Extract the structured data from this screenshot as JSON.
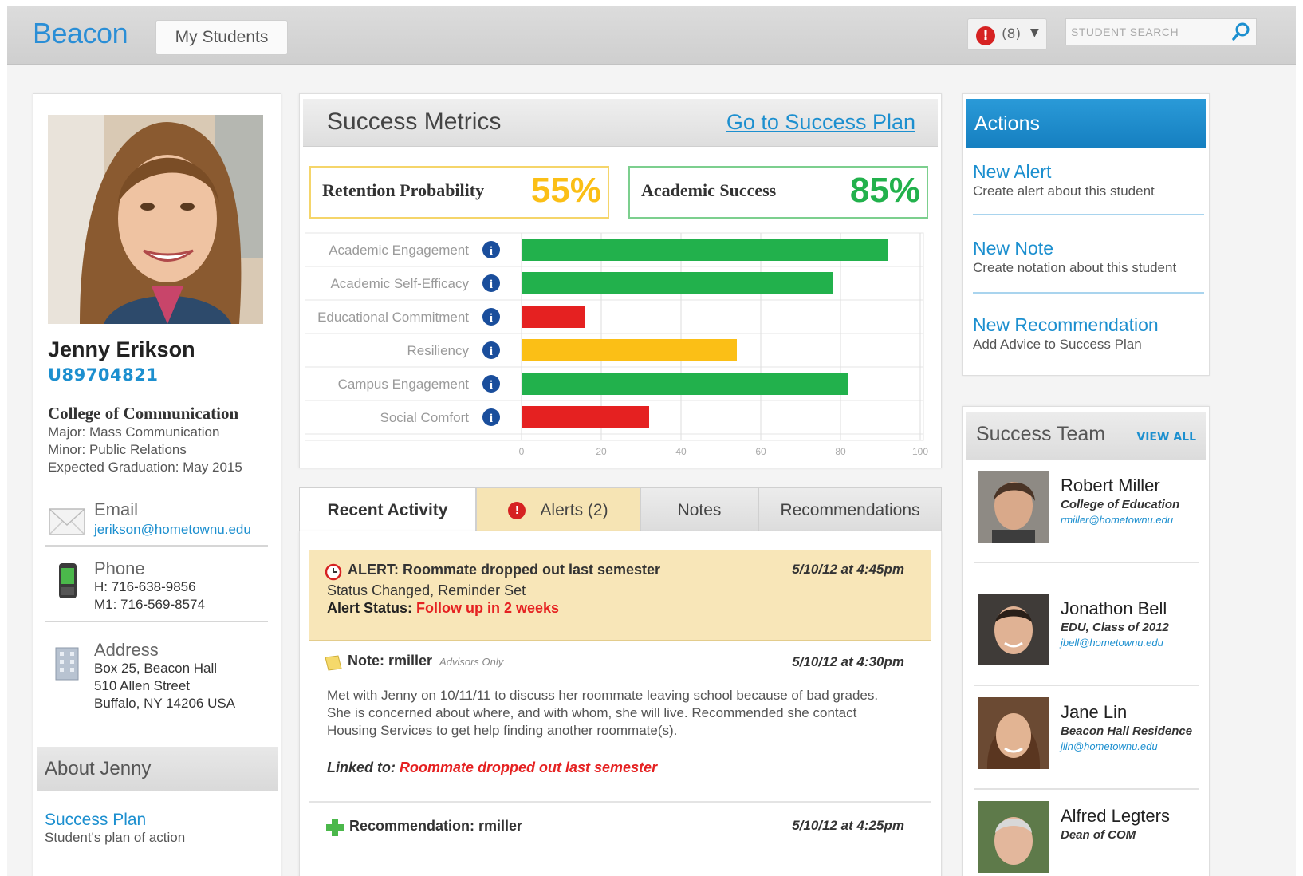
{
  "app": {
    "logo": "Beacon",
    "nav_button": "My Students",
    "alert_count": "(8)",
    "search_placeholder": "STUDENT SEARCH"
  },
  "student": {
    "name": "Jenny Erikson",
    "id": "U89704821",
    "college": "College of Communication",
    "major": "Major: Mass Communication",
    "minor": "Minor: Public Relations",
    "graduation": "Expected Graduation: May 2015",
    "email_label": "Email",
    "email": "jerikson@hometownu.edu",
    "phone_label": "Phone",
    "phone_h": "H:  716-638-9856",
    "phone_m1": "M1: 716-569-8574",
    "address_label": "Address",
    "address_1": "Box 25, Beacon Hall",
    "address_2": "510 Allen Street",
    "address_3": "Buffalo, NY 14206 USA",
    "about_title": "About Jenny",
    "success_plan_link": "Success Plan",
    "success_plan_desc": "Student's plan of action"
  },
  "metrics": {
    "title": "Success Metrics",
    "goto_link": "Go to Success Plan",
    "retention_label": "Retention Probability",
    "retention_value": "55%",
    "academic_label": "Academic Success",
    "academic_value": "85%",
    "colors": {
      "green": "#22b14c",
      "red": "#e52121",
      "yellow": "#fbbf16"
    }
  },
  "chart_data": {
    "type": "bar",
    "orientation": "horizontal",
    "categories": [
      "Academic Engagement",
      "Academic Self-Efficacy",
      "Educational Commitment",
      "Resiliency",
      "Campus Engagement",
      "Social Comfort"
    ],
    "values": [
      92,
      78,
      16,
      54,
      82,
      32
    ],
    "colors": [
      "#22b14c",
      "#22b14c",
      "#e52121",
      "#fbbf16",
      "#22b14c",
      "#e52121"
    ],
    "xlim": [
      0,
      100
    ],
    "xticks": [
      "0",
      "20",
      "40",
      "60",
      "80",
      "100"
    ],
    "grid": true,
    "info_icon": "info-icon"
  },
  "tabs": {
    "recent": "Recent Activity",
    "alerts": "Alerts (2)",
    "notes": "Notes",
    "recommendations": "Recommendations"
  },
  "activity": {
    "alert_title": "ALERT: Roommate dropped out last semester",
    "alert_date": "5/10/12 at 4:45pm",
    "alert_line2": "Status Changed, Reminder Set",
    "alert_status_label": "Alert Status:",
    "alert_status_value": "Follow up in 2 weeks",
    "note_title": "Note: rmiller",
    "note_tag": "Advisors Only",
    "note_date": "5/10/12 at 4:30pm",
    "note_body_1": "Met with Jenny on 10/11/11 to discuss her roommate leaving school because of bad grades.",
    "note_body_2": "She is concerned about where, and with whom, she will live. Recommended she contact",
    "note_body_3": "Housing Services to get help finding another roommate(s).",
    "linked_label": "Linked to:",
    "linked_value": "Roommate dropped out last semester",
    "rec_title": "Recommendation: rmiller",
    "rec_date": "5/10/12 at 4:25pm"
  },
  "actions": {
    "title": "Actions",
    "items": [
      {
        "title": "New Alert",
        "desc": "Create alert about this student"
      },
      {
        "title": "New Note",
        "desc": "Create notation about this student"
      },
      {
        "title": "New Recommendation",
        "desc": "Add Advice to Success Plan"
      }
    ]
  },
  "team": {
    "title": "Success Team",
    "view_all": "VIEW ALL",
    "members": [
      {
        "name": "Robert Miller",
        "role": "College of Education",
        "email": "rmiller@hometownu.edu"
      },
      {
        "name": "Jonathon Bell",
        "role": "EDU, Class of 2012",
        "email": "jbell@hometownu.edu"
      },
      {
        "name": "Jane Lin",
        "role": "Beacon Hall Residence",
        "email": "jlin@hometownu.edu"
      },
      {
        "name": "Alfred Legters",
        "role": "Dean of COM",
        "email": ""
      }
    ]
  }
}
